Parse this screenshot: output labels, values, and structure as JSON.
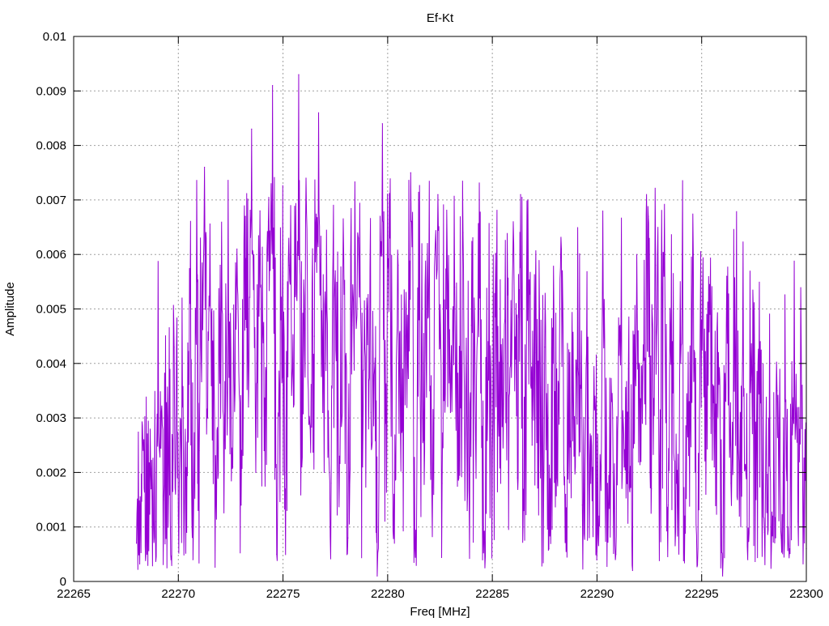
{
  "chart_data": {
    "type": "line",
    "title": "Ef-Kt",
    "xlabel": "Freq [MHz]",
    "ylabel": "Amplitude",
    "xlim": [
      22265,
      22300
    ],
    "ylim": [
      0,
      0.01
    ],
    "x_ticks": [
      "22265",
      "22270",
      "22275",
      "22280",
      "22285",
      "22290",
      "22295",
      "22300"
    ],
    "y_ticks": [
      "0",
      "0.001",
      "0.002",
      "0.003",
      "0.004",
      "0.005",
      "0.006",
      "0.007",
      "0.008",
      "0.009",
      "0.01"
    ],
    "grid": true,
    "legend": "none",
    "series": [
      {
        "color": "#9400d3",
        "x_start": 22268.0,
        "x_end": 22300.0,
        "points": [
          [
            22268.0,
            0.0007
          ],
          [
            22268.2,
            0.0012
          ],
          [
            22268.35,
            0.0026
          ],
          [
            22268.5,
            0.0005
          ],
          [
            22268.7,
            0.0017
          ],
          [
            22268.9,
            0.0011
          ],
          [
            22269.1,
            0.0024
          ],
          [
            22269.3,
            0.0015
          ],
          [
            22269.5,
            0.003
          ],
          [
            22269.65,
            0.0004
          ],
          [
            22269.8,
            0.0043
          ],
          [
            22270.0,
            0.0012
          ],
          [
            22270.2,
            0.0032
          ],
          [
            22270.4,
            0.0009
          ],
          [
            22270.55,
            0.0051
          ],
          [
            22270.7,
            0.0004
          ],
          [
            22270.9,
            0.0055
          ],
          [
            22271.0,
            0.0024
          ],
          [
            22271.25,
            0.0076
          ],
          [
            22271.4,
            0.003
          ],
          [
            22271.6,
            0.005
          ],
          [
            22271.8,
            0.0016
          ],
          [
            22272.0,
            0.0058
          ],
          [
            22272.2,
            0.0026
          ],
          [
            22272.4,
            0.0049
          ],
          [
            22272.6,
            0.0021
          ],
          [
            22272.8,
            0.0061
          ],
          [
            22273.0,
            0.0014
          ],
          [
            22273.2,
            0.0067
          ],
          [
            22273.35,
            0.0032
          ],
          [
            22273.5,
            0.0083
          ],
          [
            22273.7,
            0.002
          ],
          [
            22273.9,
            0.0068
          ],
          [
            22274.1,
            0.0024
          ],
          [
            22274.3,
            0.0066
          ],
          [
            22274.5,
            0.0091
          ],
          [
            22274.7,
            0.0005
          ],
          [
            22274.9,
            0.0048
          ],
          [
            22275.1,
            0.0017
          ],
          [
            22275.3,
            0.0058
          ],
          [
            22275.5,
            0.0032
          ],
          [
            22275.75,
            0.0093
          ],
          [
            22275.9,
            0.0021
          ],
          [
            22276.1,
            0.0074
          ],
          [
            22276.3,
            0.0028
          ],
          [
            22276.5,
            0.0045
          ],
          [
            22276.7,
            0.0086
          ],
          [
            22276.9,
            0.0031
          ],
          [
            22277.1,
            0.005
          ],
          [
            22277.3,
            0.0018
          ],
          [
            22277.5,
            0.0057
          ],
          [
            22277.7,
            0.0023
          ],
          [
            22277.9,
            0.006
          ],
          [
            22278.1,
            0.0008
          ],
          [
            22278.3,
            0.0047
          ],
          [
            22278.6,
            0.0063
          ],
          [
            22278.8,
            0.0021
          ],
          [
            22279.0,
            0.0052
          ],
          [
            22279.2,
            0.0031
          ],
          [
            22279.4,
            0.0041
          ],
          [
            22279.5,
            0.0001
          ],
          [
            22279.75,
            0.0084
          ],
          [
            22279.9,
            0.0029
          ],
          [
            22280.1,
            0.0063
          ],
          [
            22280.3,
            0.0016
          ],
          [
            22280.5,
            0.0058
          ],
          [
            22280.7,
            0.0028
          ],
          [
            22280.9,
            0.0046
          ],
          [
            22281.1,
            0.0075
          ],
          [
            22281.3,
            0.0006
          ],
          [
            22281.5,
            0.0048
          ],
          [
            22281.7,
            0.0026
          ],
          [
            22281.9,
            0.0062
          ],
          [
            22282.1,
            0.002
          ],
          [
            22282.4,
            0.0071
          ],
          [
            22282.6,
            0.0018
          ],
          [
            22282.8,
            0.005
          ],
          [
            22283.0,
            0.0031
          ],
          [
            22283.2,
            0.0054
          ],
          [
            22283.4,
            0.0019
          ],
          [
            22283.6,
            0.0064
          ],
          [
            22283.8,
            0.0013
          ],
          [
            22284.0,
            0.0047
          ],
          [
            22284.2,
            0.0026
          ],
          [
            22284.4,
            0.0052
          ],
          [
            22284.6,
            0.0009
          ],
          [
            22284.8,
            0.0044
          ],
          [
            22285.0,
            0.0024
          ],
          [
            22285.2,
            0.0055
          ],
          [
            22285.4,
            0.0018
          ],
          [
            22285.6,
            0.0048
          ],
          [
            22285.8,
            0.0034
          ],
          [
            22286.0,
            0.0066
          ],
          [
            22286.2,
            0.0019
          ],
          [
            22286.35,
            0.0071
          ],
          [
            22286.5,
            0.0013
          ],
          [
            22286.7,
            0.007
          ],
          [
            22286.9,
            0.0025
          ],
          [
            22287.1,
            0.0042
          ],
          [
            22287.3,
            0.0019
          ],
          [
            22287.5,
            0.0043
          ],
          [
            22287.7,
            0.0006
          ],
          [
            22287.9,
            0.004
          ],
          [
            22288.1,
            0.0019
          ],
          [
            22288.3,
            0.0061
          ],
          [
            22288.5,
            0.0016
          ],
          [
            22288.7,
            0.0042
          ],
          [
            22288.9,
            0.0023
          ],
          [
            22289.1,
            0.0039
          ],
          [
            22289.3,
            0.0014
          ],
          [
            22289.5,
            0.0042
          ],
          [
            22289.7,
            0.0018
          ],
          [
            22289.9,
            0.0034
          ],
          [
            22290.1,
            0.0012
          ],
          [
            22290.3,
            0.005
          ],
          [
            22290.5,
            0.0018
          ],
          [
            22290.7,
            0.0033
          ],
          [
            22290.9,
            0.0005
          ],
          [
            22291.1,
            0.0047
          ],
          [
            22291.3,
            0.0021
          ],
          [
            22291.5,
            0.0039
          ],
          [
            22291.7,
            0.0002
          ],
          [
            22291.9,
            0.006
          ],
          [
            22292.1,
            0.0022
          ],
          [
            22292.3,
            0.0041
          ],
          [
            22292.45,
            0.0067
          ],
          [
            22292.6,
            0.0017
          ],
          [
            22292.8,
            0.0058
          ],
          [
            22293.0,
            0.0023
          ],
          [
            22293.2,
            0.0056
          ],
          [
            22293.4,
            0.0014
          ],
          [
            22293.6,
            0.0044
          ],
          [
            22293.8,
            0.0018
          ],
          [
            22294.0,
            0.004
          ],
          [
            22294.2,
            0.0012
          ],
          [
            22294.4,
            0.0033
          ],
          [
            22294.6,
            0.006
          ],
          [
            22294.8,
            0.0003
          ],
          [
            22295.0,
            0.0048
          ],
          [
            22295.2,
            0.0016
          ],
          [
            22295.4,
            0.0049
          ],
          [
            22295.6,
            0.0021
          ],
          [
            22295.8,
            0.0042
          ],
          [
            22296.0,
            0.0001
          ],
          [
            22296.2,
            0.0056
          ],
          [
            22296.4,
            0.0018
          ],
          [
            22296.6,
            0.0043
          ],
          [
            22296.8,
            0.0012
          ],
          [
            22297.0,
            0.0034
          ],
          [
            22297.2,
            0.0004
          ],
          [
            22297.4,
            0.0037
          ],
          [
            22297.6,
            0.0015
          ],
          [
            22297.8,
            0.0044
          ],
          [
            22298.0,
            0.0009
          ],
          [
            22298.2,
            0.003
          ],
          [
            22298.4,
            0.0012
          ],
          [
            22298.6,
            0.0035
          ],
          [
            22298.8,
            0.0008
          ],
          [
            22299.0,
            0.0033
          ],
          [
            22299.2,
            0.0006
          ],
          [
            22299.4,
            0.0029
          ],
          [
            22299.6,
            0.0011
          ],
          [
            22299.8,
            0.0036
          ],
          [
            22300.0,
            0.0006
          ]
        ]
      }
    ]
  }
}
